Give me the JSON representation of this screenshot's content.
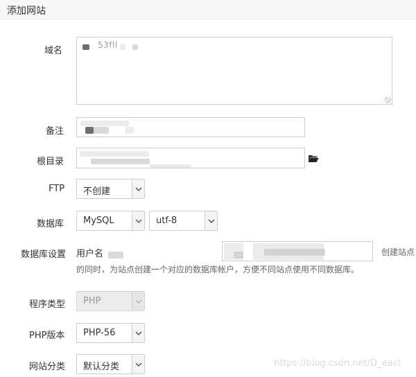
{
  "header": {
    "title": "添加网站"
  },
  "labels": {
    "domain": "域名",
    "note": "备注",
    "root": "根目录",
    "ftp": "FTP",
    "database": "数据库",
    "db_settings": "数据库设置",
    "program_type": "程序类型",
    "php_version": "PHP版本",
    "site_category": "网站分类"
  },
  "domain_text": "53fll",
  "ftp_select": {
    "value": "不创建"
  },
  "db_select": {
    "value": "MySQL"
  },
  "charset_select": {
    "value": "utf-8"
  },
  "db_user_label": "用户名",
  "db_hint_inline": "创建站点",
  "db_hint_line2": "的同时，为站点创建一个对应的数据库帐户，方便不同站点使用不同数据库。",
  "program_type_select": {
    "value": "PHP",
    "disabled": true
  },
  "php_version_select": {
    "value": "PHP-56"
  },
  "category_select": {
    "value": "默认分类"
  },
  "watermark": "https://blog.csdn.net/D_east",
  "icons": {
    "folder": "folder-open-icon",
    "dropdown": "chevron-down-icon"
  }
}
